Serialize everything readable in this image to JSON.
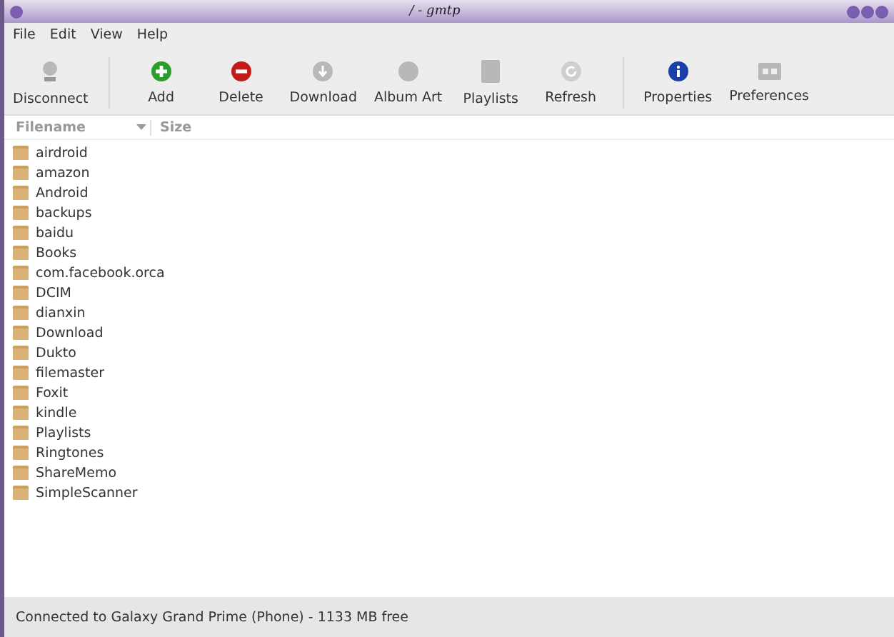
{
  "window": {
    "title": "/ - gmtp"
  },
  "menu": [
    "File",
    "Edit",
    "View",
    "Help"
  ],
  "toolbar_groups": [
    [
      {
        "kind": "disconnect",
        "label": "Disconnect"
      }
    ],
    [
      {
        "kind": "add",
        "label": "Add"
      },
      {
        "kind": "delete",
        "label": "Delete"
      },
      {
        "kind": "download",
        "label": "Download"
      },
      {
        "kind": "albumart",
        "label": "Album Art"
      },
      {
        "kind": "playlists",
        "label": "Playlists"
      },
      {
        "kind": "refresh",
        "label": "Refresh"
      }
    ],
    [
      {
        "kind": "properties",
        "label": "Properties"
      },
      {
        "kind": "preferences",
        "label": "Preferences"
      }
    ]
  ],
  "table": {
    "columns": [
      "Filename",
      "Size"
    ],
    "rows": [
      "airdroid",
      "amazon",
      "Android",
      "backups",
      "baidu",
      "Books",
      "com.facebook.orca",
      "DCIM",
      "dianxin",
      "Download",
      "Dukto",
      "filemaster",
      "Foxit",
      "kindle",
      "Playlists",
      "Ringtones",
      "ShareMemo",
      "SimpleScanner"
    ]
  },
  "status_bar": "Connected to Galaxy Grand Prime (Phone) - 1133 MB free"
}
